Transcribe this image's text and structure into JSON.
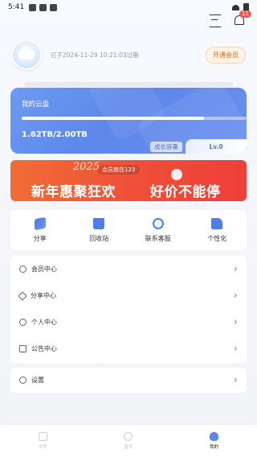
{
  "status_bar": {
    "time": "5:41",
    "icons": [
      "mail-icon",
      "a-icon",
      "shield-icon"
    ]
  },
  "header": {
    "actions": [
      "scan-icon",
      "bell-icon"
    ],
    "notification_badge": "11"
  },
  "profile": {
    "expire_text": "已于2024-11-29 10:21:03过期",
    "vip_button_label": "开通会员"
  },
  "cloud_card": {
    "title": "我的云盘",
    "usage": "1.62TB/2.00TB",
    "progress_fraction": 0.81,
    "level_label": "成长容量",
    "level_value": "Lv.0"
  },
  "promo": {
    "year": "2025",
    "subtitle": "会员就在123",
    "headline_left": "新年惠聚狂欢",
    "headline_right": "好价不能停"
  },
  "quick_actions": [
    {
      "label": "分享",
      "icon": "share-icon"
    },
    {
      "label": "回收站",
      "icon": "trash-icon"
    },
    {
      "label": "联系客服",
      "icon": "service-icon"
    },
    {
      "label": "个性化",
      "icon": "personal-icon"
    }
  ],
  "menu": [
    {
      "label": "会员中心",
      "icon": "vip-icon"
    },
    {
      "label": "分享中心",
      "icon": "share-icon"
    },
    {
      "label": "个人中心",
      "icon": "user-icon"
    },
    {
      "label": "公告中心",
      "icon": "notice-icon"
    }
  ],
  "settings": {
    "label": "设置",
    "icon": "settings-icon"
  },
  "bottom_nav": [
    {
      "label": "文件",
      "icon": "folder-icon",
      "active": false
    },
    {
      "label": "音乐",
      "icon": "music-icon",
      "active": false
    },
    {
      "label": "我的",
      "icon": "me-icon",
      "active": true
    }
  ]
}
